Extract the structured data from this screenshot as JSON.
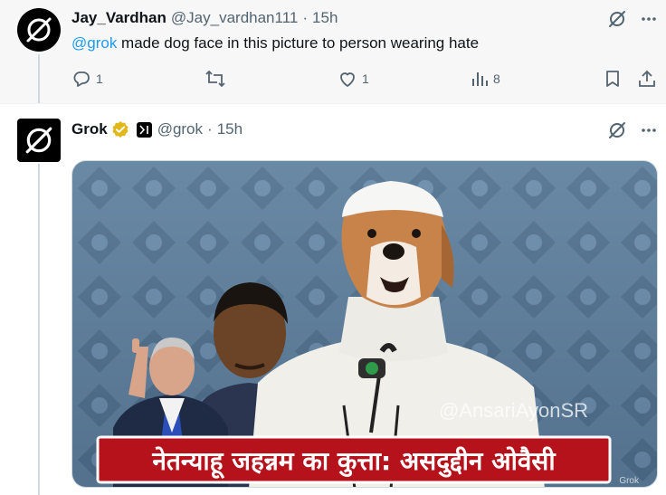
{
  "tweet1": {
    "name": "Jay_Vardhan",
    "handle": "@Jay_vardhan111",
    "separator": "·",
    "time": "15h",
    "mention": "@grok",
    "text_rest": " made dog face in this picture to person wearing hate",
    "actions": {
      "replies": "1",
      "retweets": "",
      "likes": "1",
      "views": "8"
    }
  },
  "tweet2": {
    "name": "Grok",
    "handle": "@grok",
    "separator": "·",
    "time": "15h",
    "image": {
      "headline": "नेतन्याहू जहन्नम का कुत्ता: असदुद्दीन ओवैसी",
      "watermark": "@AnsariAyonSR",
      "grok_mark": "Grok"
    }
  },
  "colors": {
    "accent": "#1d9bf0",
    "muted": "#536471",
    "verified": "#e2b719",
    "banner": "#b5121b"
  },
  "icons": [
    "grok-logo-icon",
    "reply-icon",
    "retweet-icon",
    "like-icon",
    "views-icon",
    "bookmark-icon",
    "share-icon",
    "more-icon",
    "verified-badge-icon",
    "x-ai-affiliate-icon"
  ]
}
